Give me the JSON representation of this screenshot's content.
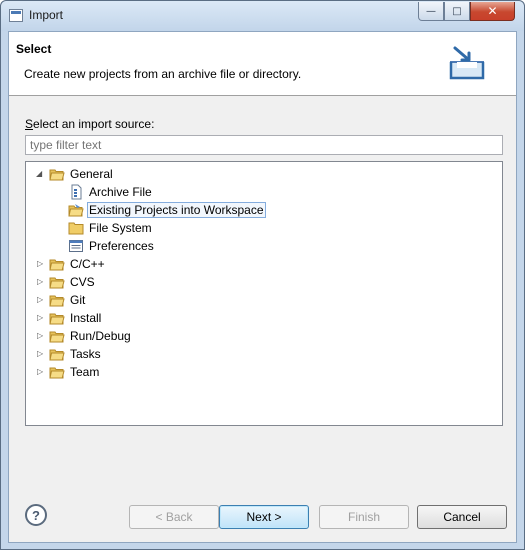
{
  "window": {
    "title": "Import"
  },
  "banner": {
    "title": "Select",
    "description": "Create new projects from an archive file or directory.",
    "icon": "import-wizard-icon"
  },
  "source": {
    "label_mnemonic": "S",
    "label_rest": "elect an import source:",
    "filter_placeholder": "type filter text"
  },
  "tree": {
    "general": {
      "label": "General",
      "children": [
        {
          "label": "Archive File",
          "icon": "archive-file-icon"
        },
        {
          "label": "Existing Projects into Workspace",
          "icon": "existing-projects-icon",
          "selected": true
        },
        {
          "label": "File System",
          "icon": "folder-icon"
        },
        {
          "label": "Preferences",
          "icon": "preferences-icon"
        }
      ]
    },
    "categories": [
      "C/C++",
      "CVS",
      "Git",
      "Install",
      "Run/Debug",
      "Tasks",
      "Team"
    ]
  },
  "buttons": {
    "back": "< Back",
    "next": "Next >",
    "finish": "Finish",
    "cancel": "Cancel"
  }
}
